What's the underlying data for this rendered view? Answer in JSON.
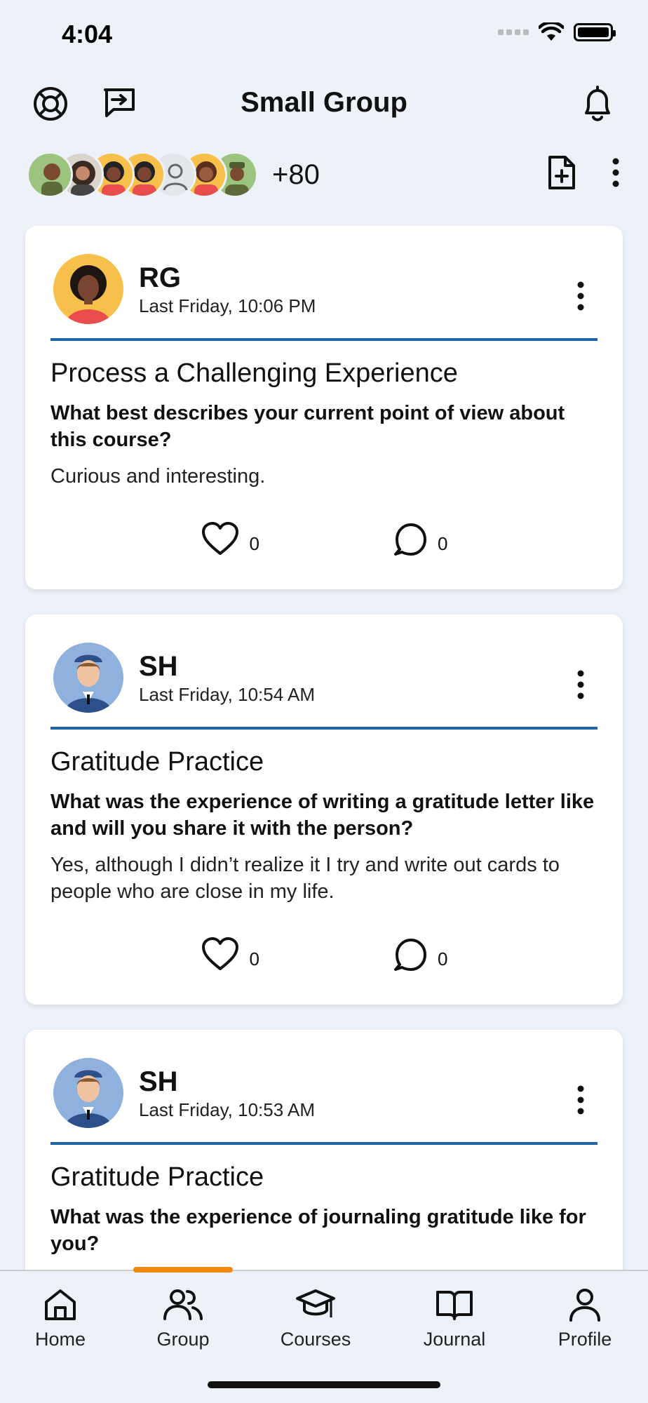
{
  "status_bar": {
    "time": "4:04"
  },
  "header": {
    "title": "Small Group",
    "left_icons": [
      "lifebuoy-icon",
      "message-square-arrow-icon"
    ],
    "right_icon": "bell-icon"
  },
  "members": {
    "more_count": "+80"
  },
  "posts": [
    {
      "author": "RG",
      "time": "Last Friday, 10:06 PM",
      "title": "Process a Challenging Experience",
      "question": "What best describes your current point of view about this course?",
      "answer": "Curious and interesting.",
      "likes": "0",
      "comments": "0"
    },
    {
      "author": "SH",
      "time": "Last Friday, 10:54 AM",
      "title": "Gratitude Practice",
      "question": "What was the experience of writing a gratitude letter like and will you share it with the person?",
      "answer": "Yes, although I didn’t realize it I try and write out cards to people who are close in my life.",
      "likes": "0",
      "comments": "0"
    },
    {
      "author": "SH",
      "time": "Last Friday, 10:53 AM",
      "title": "Gratitude Practice",
      "question": "What was the experience of journaling gratitude like for you?"
    }
  ],
  "nav": {
    "items": [
      {
        "label": "Home",
        "icon": "home-icon"
      },
      {
        "label": "Group",
        "icon": "group-icon"
      },
      {
        "label": "Courses",
        "icon": "graduation-cap-icon"
      },
      {
        "label": "Journal",
        "icon": "book-open-icon"
      },
      {
        "label": "Profile",
        "icon": "user-icon"
      }
    ],
    "active": "Group"
  },
  "colors": {
    "background": "#edf2f9",
    "divider": "#1f64a8",
    "active_indicator": "#f0880f"
  }
}
